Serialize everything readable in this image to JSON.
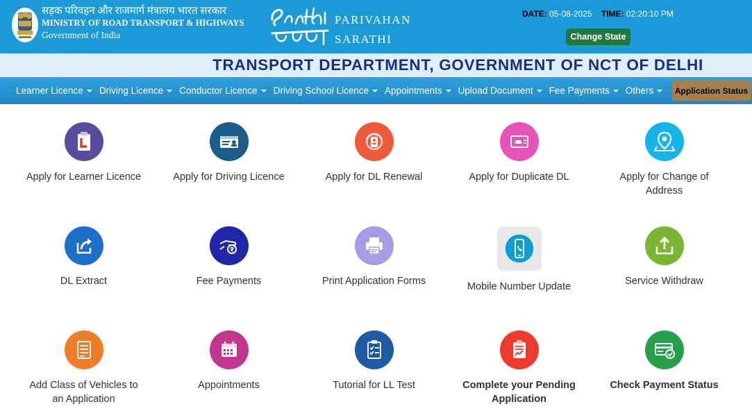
{
  "header": {
    "ministry_hindi": "सड़क परिवहन और राजमार्ग मंत्रालय भारत सरकार",
    "ministry_english": "MINISTRY OF ROAD TRANSPORT & HIGHWAYS",
    "government": "Government of India",
    "portal_line1": "PARIVAHAN",
    "portal_line2": "SARATHI",
    "date_label": "DATE:",
    "date_value": "05-08-2025",
    "time_label": "TIME:",
    "time_value": "02:20:10 PM",
    "change_state_label": "Change State",
    "department_title": "TRANSPORT DEPARTMENT, GOVERNMENT OF NCT OF DELHI"
  },
  "nav": {
    "items": [
      {
        "label": "Learner Licence"
      },
      {
        "label": "Driving Licence"
      },
      {
        "label": "Conductor Licence"
      },
      {
        "label": "Driving School Licence"
      },
      {
        "label": "Appointments"
      },
      {
        "label": "Upload Document"
      },
      {
        "label": "Fee Payments"
      },
      {
        "label": "Others"
      }
    ],
    "application_status_label": "Application Status"
  },
  "colors": {
    "topbar": "#1c9ad8",
    "title": "#1a2c8a",
    "change_state": "#1f7a3a",
    "application_status": "#a6814e"
  },
  "tiles": [
    {
      "label": "Apply for Learner Licence",
      "icon": "learner-licence-icon",
      "color": "#5b4b9f"
    },
    {
      "label": "Apply for Driving Licence",
      "icon": "driving-licence-card-icon",
      "color": "#1d5d8a"
    },
    {
      "label": "Apply for DL Renewal",
      "icon": "dl-renewal-icon",
      "color": "#ef5a3b"
    },
    {
      "label": "Apply for Duplicate DL",
      "icon": "duplicate-dl-icon",
      "color": "#e752b8"
    },
    {
      "label": "Apply for Change of Address",
      "icon": "location-pin-icon",
      "color": "#14b3ea"
    },
    {
      "label": "DL Extract",
      "icon": "share-export-icon",
      "color": "#1c6fc9"
    },
    {
      "label": "Fee Payments",
      "icon": "rupee-payment-icon",
      "color": "#1d27a8"
    },
    {
      "label": "Print Application Forms",
      "icon": "printer-icon",
      "color": "#a99ae6"
    },
    {
      "label": "Mobile Number Update",
      "icon": "mobile-phone-icon",
      "color": "#0a9fd0"
    },
    {
      "label": "Service Withdraw",
      "icon": "upload-tray-icon",
      "color": "#7bb531"
    },
    {
      "label": "Add Class of Vehicles to an Application",
      "icon": "form-document-icon",
      "color": "#f07c28"
    },
    {
      "label": "Appointments",
      "icon": "calendar-icon",
      "color": "#c0378d"
    },
    {
      "label": "Tutorial for LL Test",
      "icon": "checklist-clipboard-icon",
      "color": "#1d5aa3"
    },
    {
      "label": "Complete your Pending Application",
      "icon": "pending-clipboard-icon",
      "color": "#ee3a2c",
      "bold": true
    },
    {
      "label": "Check Payment Status",
      "icon": "payment-card-check-icon",
      "color": "#27a04e",
      "bold": true
    }
  ]
}
